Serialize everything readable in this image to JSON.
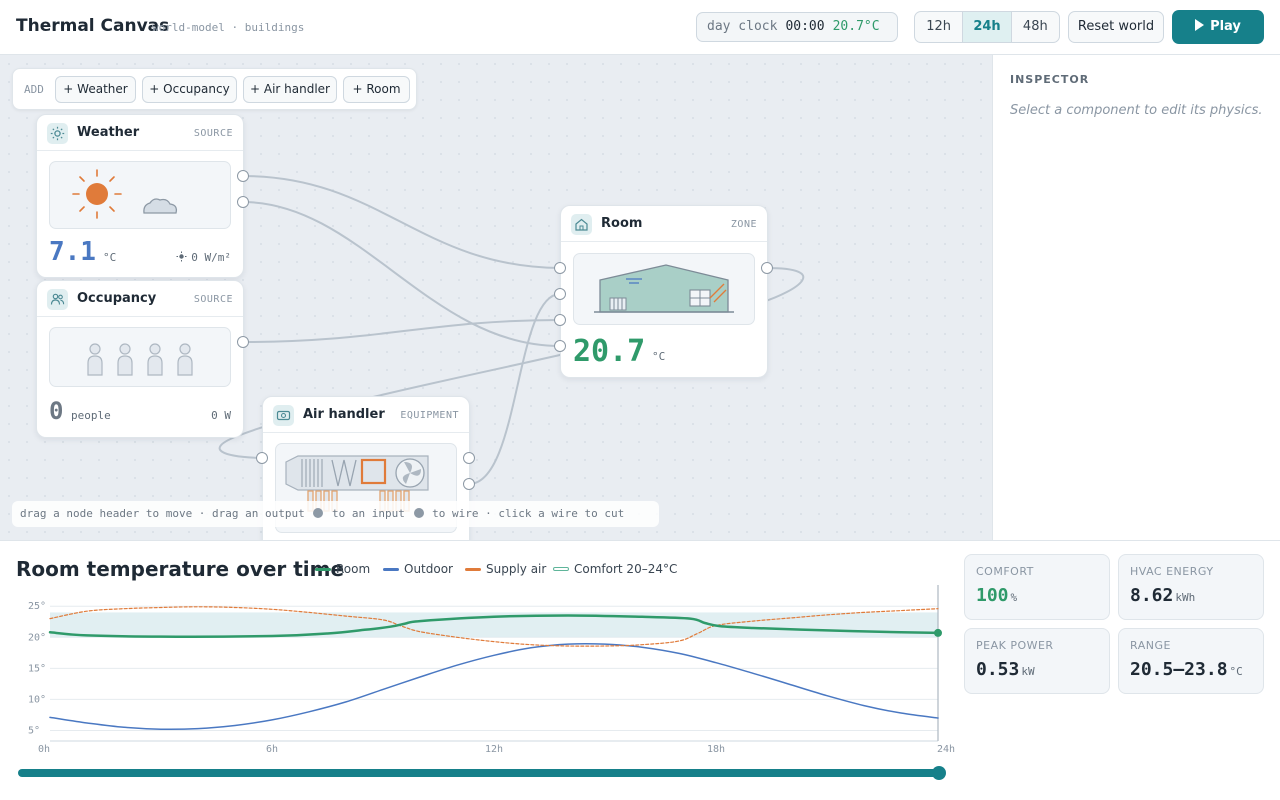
{
  "header": {
    "title": "Thermal Canvas",
    "subtitle": "world-model · buildings",
    "clock_label": "day clock",
    "clock_time": "00:00",
    "clock_temp": "20.7°C",
    "ranges": [
      "12h",
      "24h",
      "48h"
    ],
    "active_range": "24h",
    "reset_label": "Reset world",
    "play_label": "Play"
  },
  "toolbar": {
    "add_label": "ADD",
    "buttons": [
      "+ Weather",
      "+ Occupancy",
      "+ Air handler",
      "+ Room"
    ]
  },
  "nodes": {
    "weather": {
      "title": "Weather",
      "kind": "SOURCE",
      "temp": "7.1",
      "temp_unit": "°C",
      "solar": "0 W/m²"
    },
    "occupancy": {
      "title": "Occupancy",
      "kind": "SOURCE",
      "count": "0",
      "count_unit": "people",
      "load": "0 W"
    },
    "air_handler": {
      "title": "Air handler",
      "kind": "EQUIPMENT"
    },
    "room": {
      "title": "Room",
      "kind": "ZONE",
      "temp": "20.7",
      "temp_unit": "°C"
    }
  },
  "hint": {
    "part1": "drag a node header to move · drag an output",
    "part2": "to an input",
    "part3": "to wire · click a wire to cut"
  },
  "inspector": {
    "title": "INSPECTOR",
    "empty_hint": "Select a component to edit its physics."
  },
  "colors": {
    "accent": "#16808a",
    "room": "#2f9a6a",
    "outdoor": "#4a78c2",
    "supply": "#e07b3a",
    "comfort": "#5fb59a",
    "comfort_band": "#dcecf0"
  },
  "chart_data": {
    "type": "line",
    "title": "Room temperature over time",
    "x_ticks": [
      "0h",
      "6h",
      "12h",
      "18h",
      "24h"
    ],
    "y_ticks": [
      "5°",
      "10°",
      "15°",
      "20°",
      "25°"
    ],
    "xlim": [
      0,
      24
    ],
    "ylim": [
      3.3,
      26
    ],
    "comfort_band": {
      "name": "Comfort 20–24°C",
      "low": 20,
      "high": 24
    },
    "series": [
      {
        "name": "Room",
        "x": [
          0,
          1,
          3,
          6,
          7.5,
          8.5,
          9.2,
          9.6,
          10,
          12,
          14,
          16,
          17.3,
          17.7,
          18.1,
          19,
          21,
          23,
          24
        ],
        "y": [
          20.8,
          20.3,
          20.1,
          20.2,
          20.6,
          21.2,
          21.7,
          22.2,
          22.6,
          23.3,
          23.5,
          23.3,
          23.0,
          22.3,
          21.8,
          21.5,
          21.1,
          20.8,
          20.7
        ]
      },
      {
        "name": "Outdoor",
        "x": [
          0,
          1,
          2,
          3,
          4,
          5,
          6,
          7,
          8,
          9,
          10,
          11,
          12,
          13,
          14,
          15,
          16,
          17,
          18,
          19,
          20,
          21,
          22,
          23,
          24
        ],
        "y": [
          7.1,
          6.2,
          5.5,
          5.2,
          5.3,
          5.8,
          6.7,
          8.0,
          9.6,
          11.6,
          13.6,
          15.5,
          17.1,
          18.3,
          18.9,
          18.9,
          18.4,
          17.4,
          15.9,
          14.2,
          12.4,
          10.6,
          9.0,
          7.8,
          7.0
        ]
      },
      {
        "name": "Supply air",
        "x": [
          0,
          1,
          2,
          3,
          4,
          5,
          6,
          7,
          8,
          9,
          9.5,
          10,
          11,
          12,
          13,
          14,
          15,
          16,
          17,
          17.5,
          18,
          19,
          20,
          21,
          22,
          23,
          24
        ],
        "y": [
          23.0,
          24.2,
          24.6,
          24.8,
          24.9,
          24.8,
          24.5,
          24.0,
          23.4,
          22.8,
          21.8,
          20.9,
          20.0,
          19.3,
          18.8,
          18.6,
          18.6,
          18.8,
          19.4,
          20.6,
          21.9,
          22.6,
          23.1,
          23.6,
          24.0,
          24.3,
          24.6
        ]
      }
    ]
  },
  "progress": {
    "value": 1.0
  },
  "stats": {
    "comfort": {
      "label": "COMFORT",
      "value": "100",
      "unit": "%"
    },
    "energy": {
      "label": "HVAC ENERGY",
      "value": "8.62",
      "unit": "kWh"
    },
    "peak": {
      "label": "PEAK POWER",
      "value": "0.53",
      "unit": "kW"
    },
    "range": {
      "label": "RANGE",
      "value": "20.5–23.8",
      "unit": "°C"
    }
  }
}
